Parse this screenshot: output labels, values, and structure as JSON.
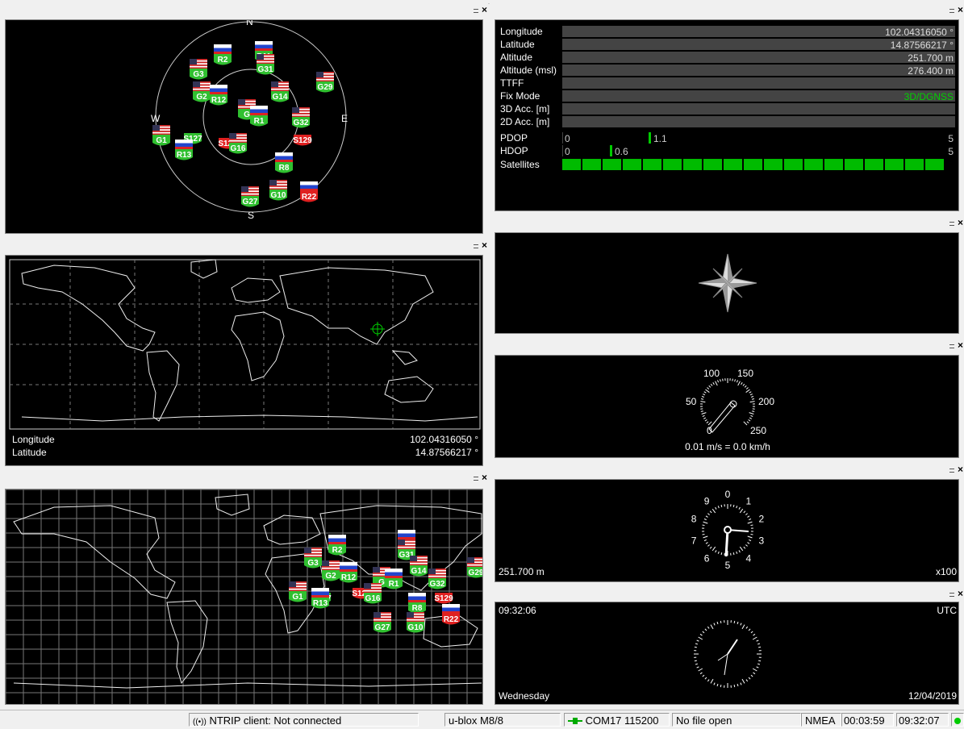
{
  "sky": {
    "compass": {
      "n": "N",
      "s": "S",
      "e": "E",
      "w": "W"
    },
    "satellites": [
      {
        "id": "R2",
        "flag": "ru",
        "bad": false
      },
      {
        "id": "R11",
        "flag": "ru",
        "bad": false
      },
      {
        "id": "G31",
        "flag": "us",
        "bad": false
      },
      {
        "id": "G3",
        "flag": "us",
        "bad": false
      },
      {
        "id": "G29",
        "flag": "us",
        "bad": false
      },
      {
        "id": "G2",
        "flag": "us",
        "bad": false
      },
      {
        "id": "R12",
        "flag": "ru",
        "bad": false
      },
      {
        "id": "G14",
        "flag": "us",
        "bad": false
      },
      {
        "id": "G",
        "flag": "us",
        "bad": false
      },
      {
        "id": "R1",
        "flag": "ru",
        "bad": false
      },
      {
        "id": "G32",
        "flag": "us",
        "bad": false
      },
      {
        "id": "G1",
        "flag": "us",
        "bad": false
      },
      {
        "id": "S127",
        "flag": "none",
        "bad": false
      },
      {
        "id": "S128",
        "flag": "none",
        "bad": true
      },
      {
        "id": "G16",
        "flag": "us",
        "bad": false
      },
      {
        "id": "S129",
        "flag": "none",
        "bad": true
      },
      {
        "id": "R13",
        "flag": "ru",
        "bad": false
      },
      {
        "id": "R8",
        "flag": "ru",
        "bad": false
      },
      {
        "id": "G10",
        "flag": "us",
        "bad": false
      },
      {
        "id": "R22",
        "flag": "ru",
        "bad": true
      },
      {
        "id": "G27",
        "flag": "us",
        "bad": false
      }
    ]
  },
  "map": {
    "longitude_label": "Longitude",
    "longitude_value": "102.04316050 °",
    "latitude_label": "Latitude",
    "latitude_value": "14.87566217 °"
  },
  "info": {
    "rows": [
      {
        "label": "Longitude",
        "value": "102.04316050 °"
      },
      {
        "label": "Latitude",
        "value": "14.87566217 °"
      },
      {
        "label": "Altitude",
        "value": "251.700 m"
      },
      {
        "label": "Altitude (msl)",
        "value": "276.400 m"
      },
      {
        "label": "TTFF",
        "value": ""
      },
      {
        "label": "Fix Mode",
        "value": "3D/DGNSS"
      },
      {
        "label": "3D Acc. [m]",
        "value": ""
      },
      {
        "label": "2D Acc. [m]",
        "value": ""
      }
    ],
    "pdop": {
      "label": "PDOP",
      "min": "0",
      "max": "5",
      "value": "1.1",
      "level": 1.1
    },
    "hdop": {
      "label": "HDOP",
      "min": "0",
      "max": "5",
      "value": "0.6",
      "level": 0.6
    },
    "satellites_label": "Satellites",
    "fix_color": "#00d000"
  },
  "speed": {
    "ticks": [
      "0",
      "50",
      "100",
      "150",
      "200",
      "250"
    ],
    "readout": "0.01 m/s = 0.0 km/h"
  },
  "altimeter": {
    "ticks": [
      "0",
      "1",
      "2",
      "3",
      "4",
      "5",
      "6",
      "7",
      "8",
      "9"
    ],
    "value": "251.700 m",
    "scale": "x100"
  },
  "clock": {
    "time": "09:32:06",
    "zone": "UTC",
    "day": "Wednesday",
    "date": "12/04/2019"
  },
  "statusbar": {
    "ntrip": "NTRIP client: Not connected",
    "receiver": "u-blox M8/8",
    "port": "COM17 115200",
    "file": "No file open",
    "protocol": "NMEA",
    "elapsed": "00:03:59",
    "time": "09:32:07"
  }
}
